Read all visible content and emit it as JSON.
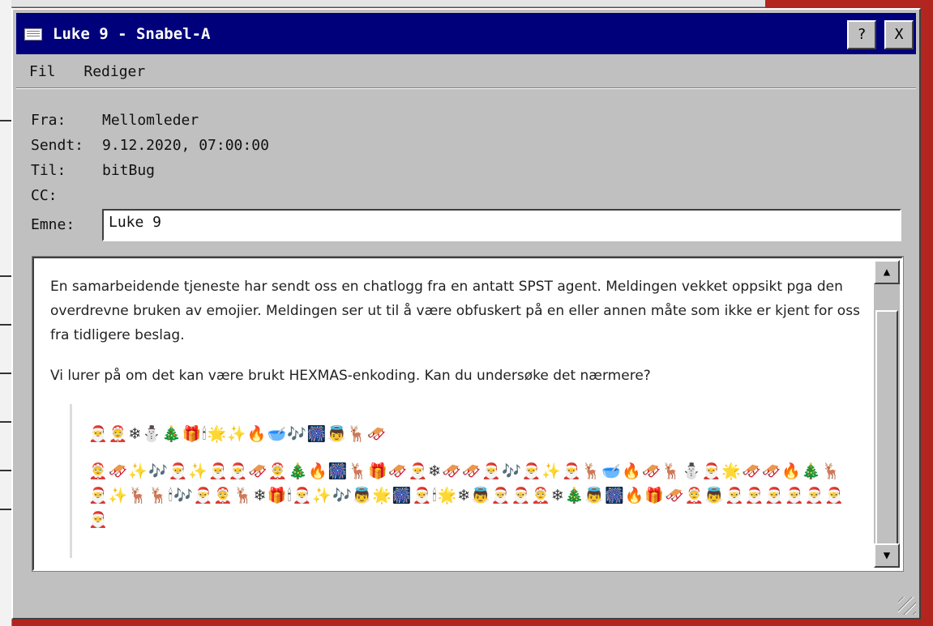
{
  "window": {
    "title": "Luke 9 - Snabel-A",
    "help_label": "?",
    "close_label": "X"
  },
  "menu": {
    "items": [
      "Fil",
      "Rediger"
    ]
  },
  "header": {
    "from_label": "Fra:",
    "from_value": "Mellomleder",
    "sent_label": "Sendt:",
    "sent_value": "9.12.2020, 07:00:00",
    "to_label": "Til:",
    "to_value": "bitBug",
    "cc_label": "CC:",
    "cc_value": "",
    "subject_label": "Emne:",
    "subject_value": "Luke 9"
  },
  "body": {
    "paragraph1": "En samarbeidende tjeneste har sendt oss en chatlogg fra en antatt SPST agent. Meldingen vekket oppsikt pga den overdrevne bruken av emojier. Meldingen ser ut til å være obfuskert på en eller annen måte som ikke er kjent for oss fra tidligere beslag.",
    "paragraph2": "Vi lurer på om det kan være brukt HEXMAS-enkoding. Kan du undersøke det nærmere?",
    "quote_line1": "🎅🤶❄⛄🎄🎁🕯🌟✨🔥🥣🎶🎆👼🦌🛷",
    "quote_line2": "🤶🛷✨🎶🎅✨🎅🎅🛷🤶🎄🔥🎆🦌🎁🛷🎅❄🛷🛷🎅🎶🎅✨🎅🦌🥣🔥🛷🦌⛄🎅🌟🛷🛷🔥🎄🦌🎅✨🦌🦌🕯🎶🎅🤶🦌❄🎁🕯🎅✨🎶👼🌟🎆🎅🕯🌟❄👼🎅🎅🤶❄🎄👼🎆🔥🎁🛷🤶👼🎅🎅🎅🎅🎅🎅🎅"
  },
  "scrollbar": {
    "up_icon": "▲",
    "down_icon": "▼"
  },
  "colors": {
    "titlebar": "#00007b",
    "window_face": "#c0c0c0",
    "desktop": "#b3261f"
  }
}
